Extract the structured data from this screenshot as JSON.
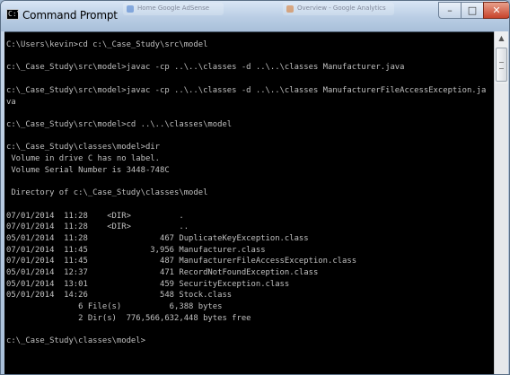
{
  "window": {
    "title": "Command Prompt",
    "icon": "console-icon",
    "controls": {
      "minimize": "–",
      "maximize": "□",
      "close": "✕"
    }
  },
  "background_tabs": [
    {
      "label": "Home Google AdSense"
    },
    {
      "label": "Overview - Google Analytics"
    }
  ],
  "console": {
    "lines": [
      "C:\\Users\\kevin>cd c:\\_Case_Study\\src\\model",
      "",
      "c:\\_Case_Study\\src\\model>javac -cp ..\\..\\classes -d ..\\..\\classes Manufacturer.java",
      "",
      "c:\\_Case_Study\\src\\model>javac -cp ..\\..\\classes -d ..\\..\\classes ManufacturerFileAccessException.ja",
      "va",
      "",
      "c:\\_Case_Study\\src\\model>cd ..\\..\\classes\\model",
      "",
      "c:\\_Case_Study\\classes\\model>dir",
      " Volume in drive C has no label.",
      " Volume Serial Number is 3448-748C",
      "",
      " Directory of c:\\_Case_Study\\classes\\model",
      "",
      "07/01/2014  11:28    <DIR>          .",
      "07/01/2014  11:28    <DIR>          ..",
      "05/01/2014  11:28               467 DuplicateKeyException.class",
      "07/01/2014  11:45             3,956 Manufacturer.class",
      "07/01/2014  11:45               487 ManufacturerFileAccessException.class",
      "05/01/2014  12:37               471 RecordNotFoundException.class",
      "05/01/2014  13:01               459 SecurityException.class",
      "05/01/2014  14:26               548 Stock.class",
      "               6 File(s)          6,388 bytes",
      "               2 Dir(s)  776,566,632,448 bytes free",
      "",
      "c:\\_Case_Study\\classes\\model>"
    ]
  },
  "colors": {
    "console_background": "#000000",
    "console_text": "#c0c0c0",
    "titlebar": "#b9cde4",
    "close_button": "#c7432b"
  }
}
